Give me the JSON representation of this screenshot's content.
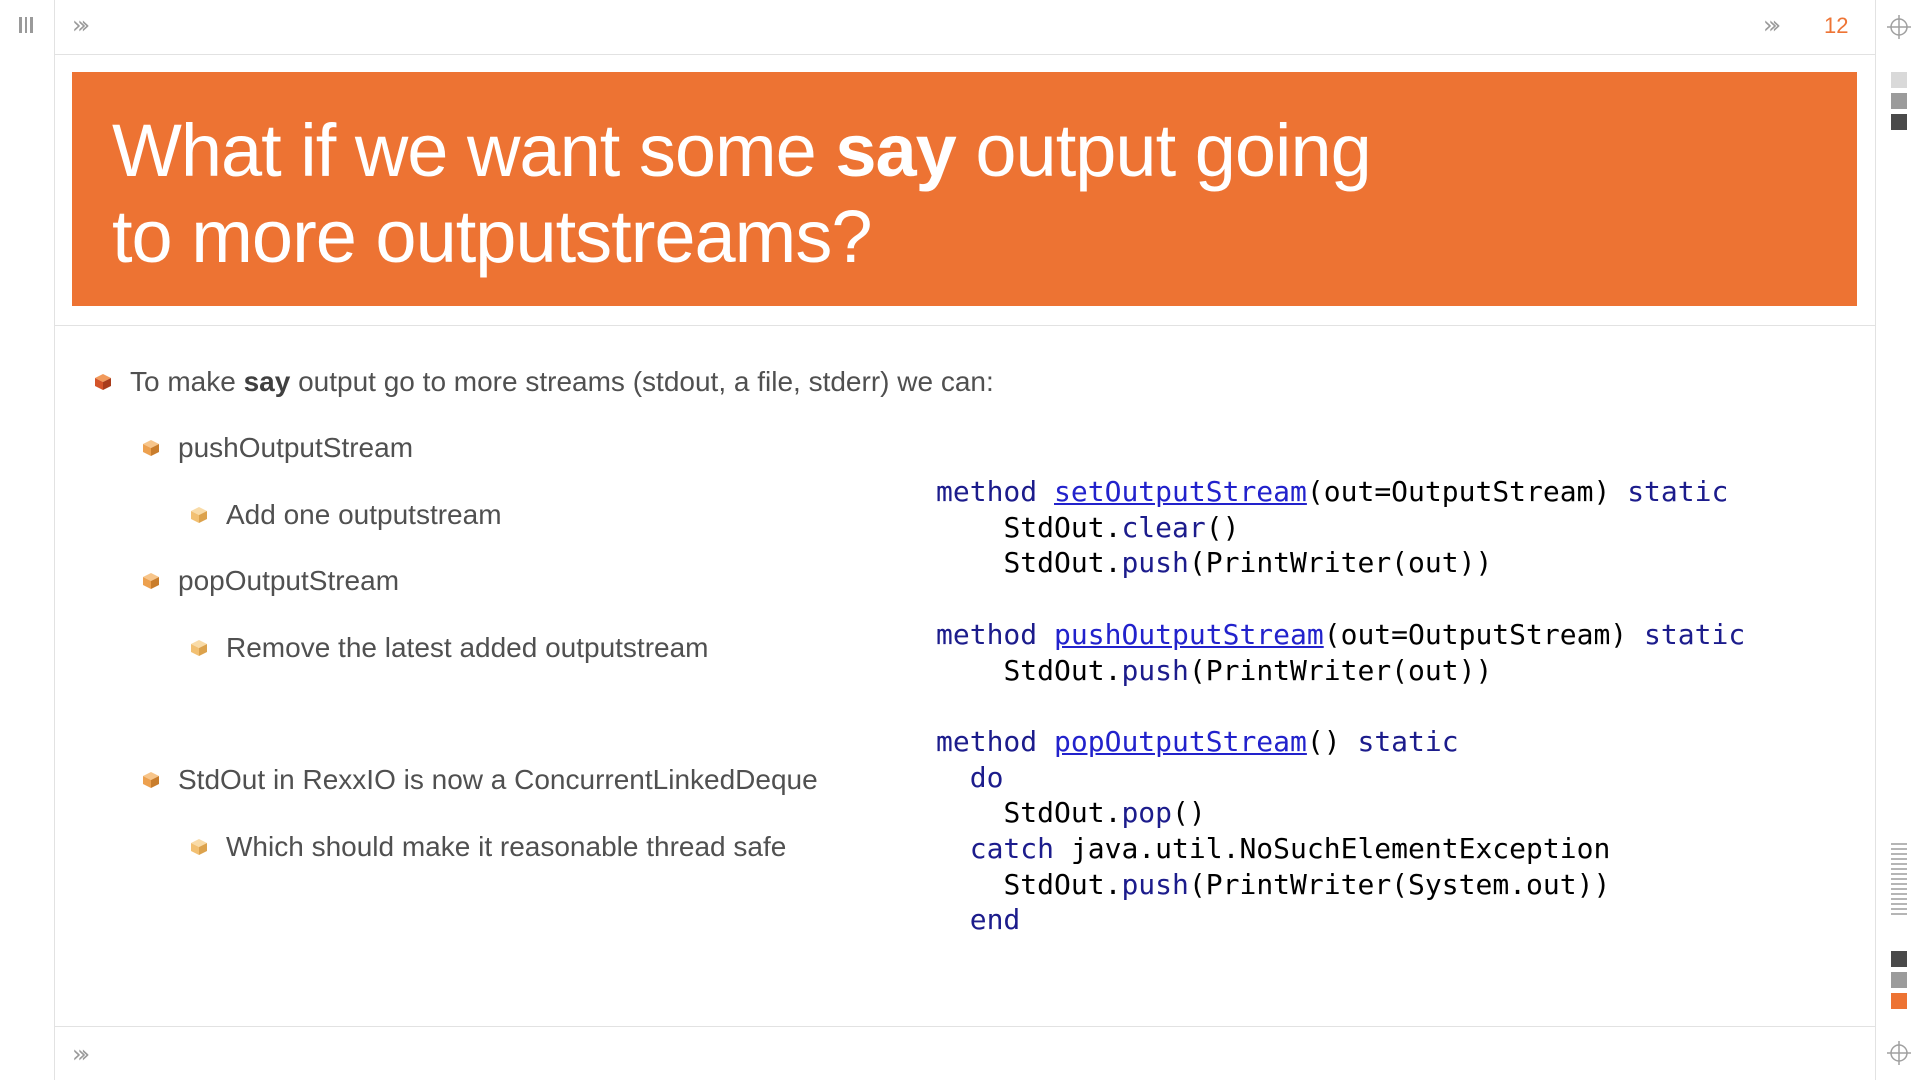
{
  "top_bar": {
    "left_chevron": "»›",
    "right_chevron": "»›",
    "page_number": "12"
  },
  "bottom_bar": {
    "left_chevron": "»›"
  },
  "slide": {
    "title_part1": "What if we want some ",
    "title_bold": "say",
    "title_part2": " output going",
    "title_line2": "to more outputstreams?",
    "bullets": {
      "main_pre": "To make ",
      "main_bold": "say",
      "main_post": " output go to more streams (stdout, a file, stderr) we can:",
      "push": "pushOutputStream",
      "push_sub": "Add one outputstream",
      "pop": "popOutputStream",
      "pop_sub": "Remove the latest added outputstream",
      "stdout": "StdOut in RexxIO is now a ConcurrentLinkedDeque",
      "stdout_sub": "Which should make it reasonable thread safe"
    },
    "code": {
      "l1_kw": "method",
      "l1_fn": "setOutputStream",
      "l1_args": "(out=OutputStream) ",
      "l1_static": "static",
      "l2_obj": "StdOut.",
      "l2_call": "clear",
      "l2_rest": "()",
      "l3_obj": "StdOut.",
      "l3_call": "push",
      "l3_rest": "(PrintWriter(out))",
      "l5_kw": "method",
      "l5_fn": "pushOutputStream",
      "l5_args": "(out=OutputStream) ",
      "l5_static": "static",
      "l6_obj": "StdOut.",
      "l6_call": "push",
      "l6_rest": "(PrintWriter(out))",
      "l8_kw": "method",
      "l8_fn": "popOutputStream",
      "l8_args": "() ",
      "l8_static": "static",
      "l9_kw": "do",
      "l10_obj": "StdOut.",
      "l10_call": "pop",
      "l10_rest": "()",
      "l11_kw": "catch",
      "l11_rest": " java.util.NoSuchElementException",
      "l12_obj": "StdOut.",
      "l12_call": "push",
      "l12_rest": "(PrintWriter(System.out))",
      "l13_kw": "end"
    }
  },
  "colors": {
    "accent": "#ed7333",
    "keyword": "#1c1c8c",
    "function_link": "#2222cc",
    "text": "#505050"
  },
  "icons": [
    "sidebar-toggle-icon",
    "chevron-right-icon",
    "crosshair-icon",
    "cube-bullet-icon"
  ]
}
